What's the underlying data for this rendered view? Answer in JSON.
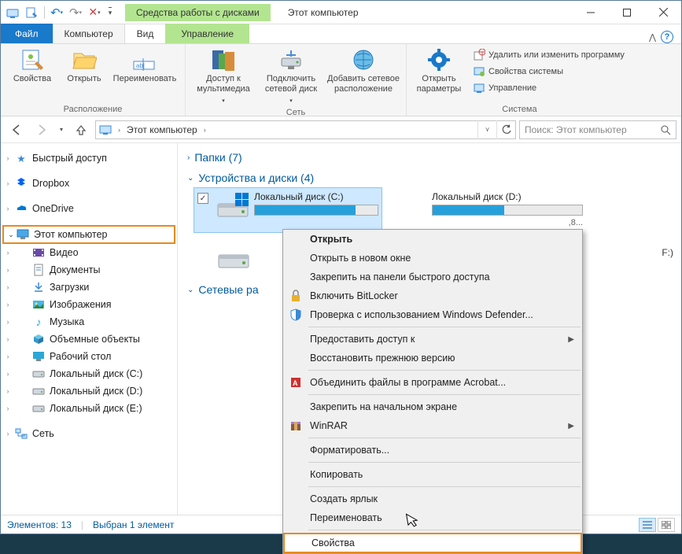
{
  "titlebar": {
    "context_tab": "Средства работы с дисками",
    "title": "Этот компьютер"
  },
  "tabs": {
    "file": "Файл",
    "computer": "Компьютер",
    "view": "Вид",
    "manage": "Управление"
  },
  "ribbon": {
    "loc": {
      "props": "Свойства",
      "open": "Открыть",
      "rename": "Переименовать",
      "group": "Расположение"
    },
    "net": {
      "media": "Доступ к мультимедиа",
      "map": "Подключить сетевой диск",
      "addnet": "Добавить сетевое расположение",
      "group": "Сеть"
    },
    "sys": {
      "settings": "Открыть параметры",
      "uninstall": "Удалить или изменить программу",
      "sysprops": "Свойства системы",
      "manage": "Управление",
      "group": "Система"
    }
  },
  "addr": {
    "root": "Этот компьютер",
    "search_placeholder": "Поиск: Этот компьютер"
  },
  "nav": {
    "quick": "Быстрый доступ",
    "dropbox": "Dropbox",
    "onedrive": "OneDrive",
    "thispc": "Этот компьютер",
    "videos": "Видео",
    "documents": "Документы",
    "downloads": "Загрузки",
    "pictures": "Изображения",
    "music": "Музыка",
    "objects3d": "Объемные объекты",
    "desktop": "Рабочий стол",
    "diskC": "Локальный диск (C:)",
    "diskD": "Локальный диск (D:)",
    "diskE": "Локальный диск (E:)",
    "network": "Сеть"
  },
  "content": {
    "folders_hdr": "Папки (7)",
    "drives_hdr": "Устройства и диски (4)",
    "netloc_hdr": "Сетевые ра",
    "driveC": {
      "name": "Локальный диск (C:)"
    },
    "driveD": {
      "name": "Локальный диск (D:)",
      "free_suffix": ",8..."
    },
    "driveF": {
      "suffix": "F:)"
    }
  },
  "ctx": {
    "open": "Открыть",
    "open_new": "Открыть в новом окне",
    "pin_quick": "Закрепить на панели быстрого доступа",
    "bitlocker": "Включить BitLocker",
    "defender": "Проверка с использованием Windows Defender...",
    "share": "Предоставить доступ к",
    "restore": "Восстановить прежнюю версию",
    "acrobat": "Объединить файлы в программе Acrobat...",
    "pin_start": "Закрепить на начальном экране",
    "winrar": "WinRAR",
    "format": "Форматировать...",
    "copy": "Копировать",
    "shortcut": "Создать ярлык",
    "rename": "Переименовать",
    "props": "Свойства"
  },
  "status": {
    "count": "Элементов: 13",
    "selected": "Выбран 1 элемент"
  }
}
